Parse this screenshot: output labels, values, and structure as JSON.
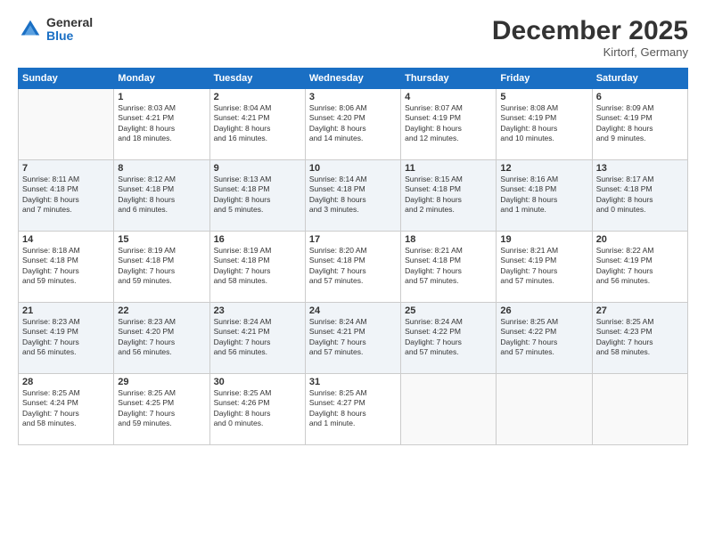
{
  "logo": {
    "general": "General",
    "blue": "Blue"
  },
  "title": "December 2025",
  "location": "Kirtorf, Germany",
  "days_of_week": [
    "Sunday",
    "Monday",
    "Tuesday",
    "Wednesday",
    "Thursday",
    "Friday",
    "Saturday"
  ],
  "weeks": [
    [
      {
        "day": "",
        "info": ""
      },
      {
        "day": "1",
        "info": "Sunrise: 8:03 AM\nSunset: 4:21 PM\nDaylight: 8 hours\nand 18 minutes."
      },
      {
        "day": "2",
        "info": "Sunrise: 8:04 AM\nSunset: 4:21 PM\nDaylight: 8 hours\nand 16 minutes."
      },
      {
        "day": "3",
        "info": "Sunrise: 8:06 AM\nSunset: 4:20 PM\nDaylight: 8 hours\nand 14 minutes."
      },
      {
        "day": "4",
        "info": "Sunrise: 8:07 AM\nSunset: 4:19 PM\nDaylight: 8 hours\nand 12 minutes."
      },
      {
        "day": "5",
        "info": "Sunrise: 8:08 AM\nSunset: 4:19 PM\nDaylight: 8 hours\nand 10 minutes."
      },
      {
        "day": "6",
        "info": "Sunrise: 8:09 AM\nSunset: 4:19 PM\nDaylight: 8 hours\nand 9 minutes."
      }
    ],
    [
      {
        "day": "7",
        "info": "Sunrise: 8:11 AM\nSunset: 4:18 PM\nDaylight: 8 hours\nand 7 minutes."
      },
      {
        "day": "8",
        "info": "Sunrise: 8:12 AM\nSunset: 4:18 PM\nDaylight: 8 hours\nand 6 minutes."
      },
      {
        "day": "9",
        "info": "Sunrise: 8:13 AM\nSunset: 4:18 PM\nDaylight: 8 hours\nand 5 minutes."
      },
      {
        "day": "10",
        "info": "Sunrise: 8:14 AM\nSunset: 4:18 PM\nDaylight: 8 hours\nand 3 minutes."
      },
      {
        "day": "11",
        "info": "Sunrise: 8:15 AM\nSunset: 4:18 PM\nDaylight: 8 hours\nand 2 minutes."
      },
      {
        "day": "12",
        "info": "Sunrise: 8:16 AM\nSunset: 4:18 PM\nDaylight: 8 hours\nand 1 minute."
      },
      {
        "day": "13",
        "info": "Sunrise: 8:17 AM\nSunset: 4:18 PM\nDaylight: 8 hours\nand 0 minutes."
      }
    ],
    [
      {
        "day": "14",
        "info": "Sunrise: 8:18 AM\nSunset: 4:18 PM\nDaylight: 7 hours\nand 59 minutes."
      },
      {
        "day": "15",
        "info": "Sunrise: 8:19 AM\nSunset: 4:18 PM\nDaylight: 7 hours\nand 59 minutes."
      },
      {
        "day": "16",
        "info": "Sunrise: 8:19 AM\nSunset: 4:18 PM\nDaylight: 7 hours\nand 58 minutes."
      },
      {
        "day": "17",
        "info": "Sunrise: 8:20 AM\nSunset: 4:18 PM\nDaylight: 7 hours\nand 57 minutes."
      },
      {
        "day": "18",
        "info": "Sunrise: 8:21 AM\nSunset: 4:18 PM\nDaylight: 7 hours\nand 57 minutes."
      },
      {
        "day": "19",
        "info": "Sunrise: 8:21 AM\nSunset: 4:19 PM\nDaylight: 7 hours\nand 57 minutes."
      },
      {
        "day": "20",
        "info": "Sunrise: 8:22 AM\nSunset: 4:19 PM\nDaylight: 7 hours\nand 56 minutes."
      }
    ],
    [
      {
        "day": "21",
        "info": "Sunrise: 8:23 AM\nSunset: 4:19 PM\nDaylight: 7 hours\nand 56 minutes."
      },
      {
        "day": "22",
        "info": "Sunrise: 8:23 AM\nSunset: 4:20 PM\nDaylight: 7 hours\nand 56 minutes."
      },
      {
        "day": "23",
        "info": "Sunrise: 8:24 AM\nSunset: 4:21 PM\nDaylight: 7 hours\nand 56 minutes."
      },
      {
        "day": "24",
        "info": "Sunrise: 8:24 AM\nSunset: 4:21 PM\nDaylight: 7 hours\nand 57 minutes."
      },
      {
        "day": "25",
        "info": "Sunrise: 8:24 AM\nSunset: 4:22 PM\nDaylight: 7 hours\nand 57 minutes."
      },
      {
        "day": "26",
        "info": "Sunrise: 8:25 AM\nSunset: 4:22 PM\nDaylight: 7 hours\nand 57 minutes."
      },
      {
        "day": "27",
        "info": "Sunrise: 8:25 AM\nSunset: 4:23 PM\nDaylight: 7 hours\nand 58 minutes."
      }
    ],
    [
      {
        "day": "28",
        "info": "Sunrise: 8:25 AM\nSunset: 4:24 PM\nDaylight: 7 hours\nand 58 minutes."
      },
      {
        "day": "29",
        "info": "Sunrise: 8:25 AM\nSunset: 4:25 PM\nDaylight: 7 hours\nand 59 minutes."
      },
      {
        "day": "30",
        "info": "Sunrise: 8:25 AM\nSunset: 4:26 PM\nDaylight: 8 hours\nand 0 minutes."
      },
      {
        "day": "31",
        "info": "Sunrise: 8:25 AM\nSunset: 4:27 PM\nDaylight: 8 hours\nand 1 minute."
      },
      {
        "day": "",
        "info": ""
      },
      {
        "day": "",
        "info": ""
      },
      {
        "day": "",
        "info": ""
      }
    ]
  ]
}
